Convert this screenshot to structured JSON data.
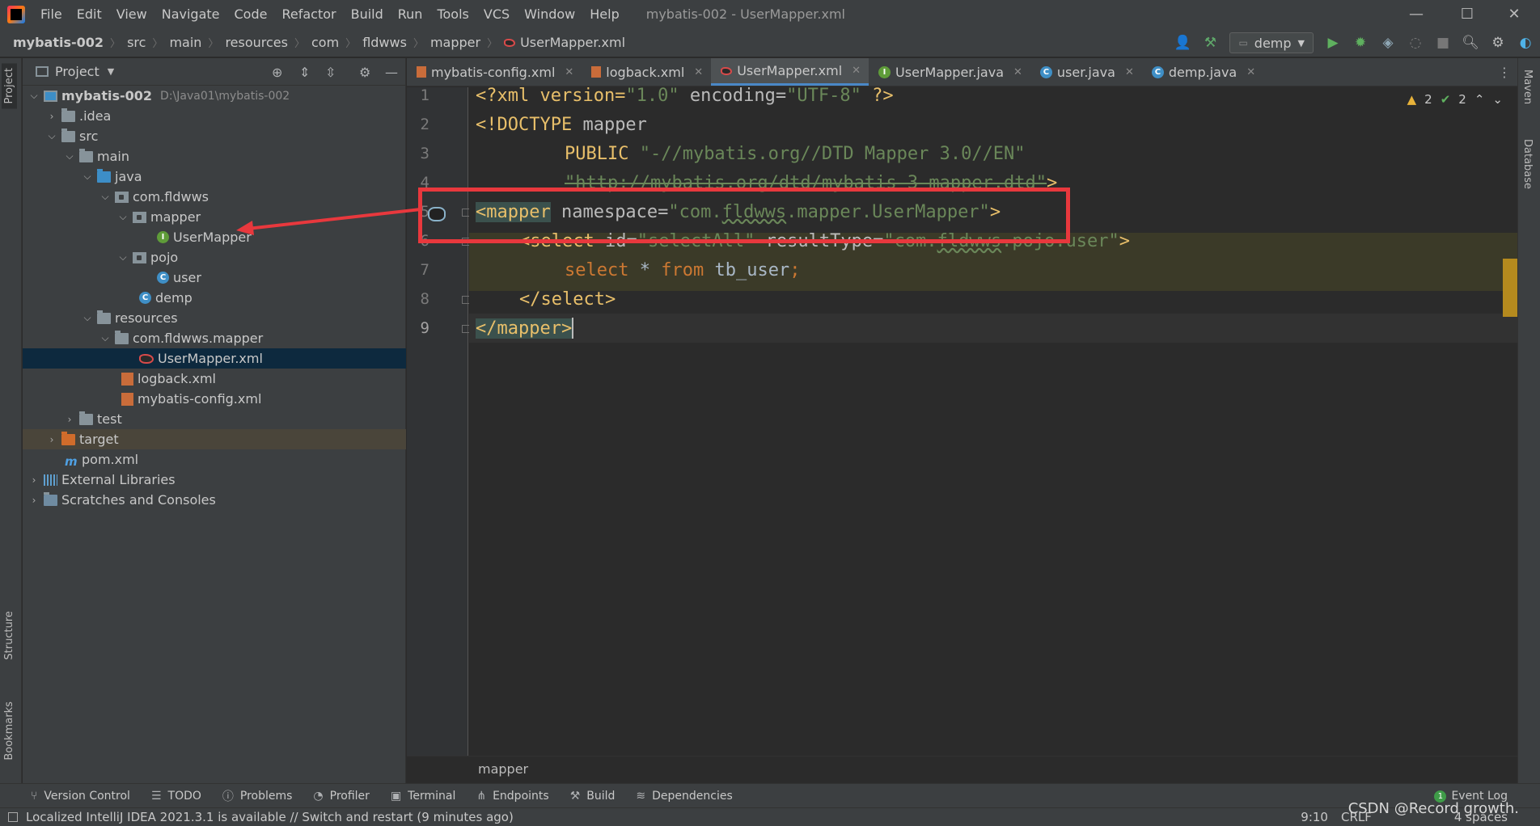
{
  "menubar": {
    "items": [
      "File",
      "Edit",
      "View",
      "Navigate",
      "Code",
      "Refactor",
      "Build",
      "Run",
      "Tools",
      "VCS",
      "Window",
      "Help"
    ],
    "window_title": "mybatis-002 - UserMapper.xml"
  },
  "navbar": {
    "crumbs": [
      "mybatis-002",
      "src",
      "main",
      "resources",
      "com",
      "fldwws",
      "mapper",
      "UserMapper.xml"
    ],
    "run_config": "demp"
  },
  "project_panel": {
    "title": "Project",
    "tree": [
      {
        "label": "mybatis-002",
        "extra": "D:\\Java01\\mybatis-002"
      },
      {
        "label": ".idea"
      },
      {
        "label": "src"
      },
      {
        "label": "main"
      },
      {
        "label": "java"
      },
      {
        "label": "com.fldwws"
      },
      {
        "label": "mapper"
      },
      {
        "label": "UserMapper"
      },
      {
        "label": "pojo"
      },
      {
        "label": "user"
      },
      {
        "label": "demp"
      },
      {
        "label": "resources"
      },
      {
        "label": "com.fldwws.mapper"
      },
      {
        "label": "UserMapper.xml"
      },
      {
        "label": "logback.xml"
      },
      {
        "label": "mybatis-config.xml"
      },
      {
        "label": "test"
      },
      {
        "label": "target"
      },
      {
        "label": "pom.xml"
      },
      {
        "label": "External Libraries"
      },
      {
        "label": "Scratches and Consoles"
      }
    ]
  },
  "editor_tabs": [
    "mybatis-config.xml",
    "logback.xml",
    "UserMapper.xml",
    "UserMapper.java",
    "user.java",
    "demp.java"
  ],
  "editor": {
    "line_numbers": [
      "1",
      "2",
      "3",
      "4",
      "5",
      "6",
      "7",
      "8",
      "9"
    ],
    "code": {
      "l1": [
        "<?xml version=",
        "\"1.0\"",
        " encoding=",
        "\"UTF-8\"",
        " ?>"
      ],
      "l2": [
        "<!DOCTYPE ",
        "mapper"
      ],
      "l3": [
        "PUBLIC ",
        "\"-//mybatis.org//DTD Mapper 3.0//EN\""
      ],
      "l4": [
        "\"http://mybatis.org/dtd/mybatis-3-mapper.dtd\"",
        ">"
      ],
      "l5": [
        "<mapper",
        " namespace=",
        "\"com.",
        "fldwws",
        ".mapper.UserMapper\"",
        ">"
      ],
      "l6": [
        "<select",
        " id=",
        "\"selectAll\"",
        " resultType=",
        "\"com.",
        "fldwws",
        ".pojo.user\"",
        ">"
      ],
      "l7": [
        "select",
        " * ",
        "from",
        " tb_user",
        ";"
      ],
      "l8": [
        "</select>"
      ],
      "l9": [
        "</mapper>"
      ]
    },
    "inspection": {
      "warnings": "2",
      "checks": "2"
    },
    "breadcrumb": "mapper"
  },
  "left_strip": {
    "project": "Project",
    "structure": "Structure",
    "bookmarks": "Bookmarks"
  },
  "right_strip": {
    "maven": "Maven",
    "database": "Database"
  },
  "bottom_tools": [
    "Version Control",
    "TODO",
    "Problems",
    "Profiler",
    "Terminal",
    "Endpoints",
    "Build",
    "Dependencies"
  ],
  "event_log": {
    "label": "Event Log",
    "count": "1"
  },
  "statusbar": {
    "message": "Localized IntelliJ IDEA 2021.3.1 is available // Switch and restart (9 minutes ago)",
    "position": "9:10",
    "line_sep": "CRLF",
    "indent": "4 spaces"
  },
  "watermark": "CSDN @Record growth.",
  "colors": {
    "accent": "#4a88c7",
    "annotation": "#e8383d",
    "tag": "#e8bf6a",
    "string": "#6a8759",
    "keyword": "#cc7832"
  }
}
